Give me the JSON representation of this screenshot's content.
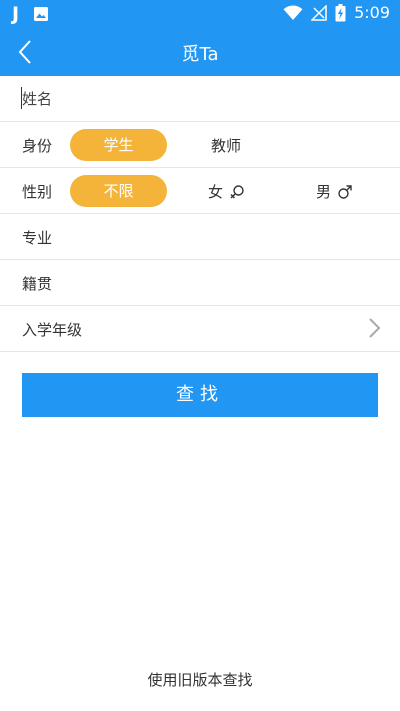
{
  "status": {
    "time": "5:09",
    "left_icons": [
      "j-app-icon",
      "image-icon"
    ],
    "right_icons": [
      "wifi-icon",
      "signal-icon",
      "battery-charging-icon"
    ]
  },
  "header": {
    "title": "觅Ta",
    "back_icon": "chevron-left-icon"
  },
  "form": {
    "name": {
      "placeholder": "姓名",
      "value": ""
    },
    "identity": {
      "label": "身份",
      "options": [
        "学生",
        "教师"
      ],
      "selected": "学生"
    },
    "gender": {
      "label": "性别",
      "options": [
        "不限",
        "女",
        "男"
      ],
      "selected": "不限",
      "icons": [
        "female-icon",
        "male-icon"
      ]
    },
    "major": {
      "label": "专业"
    },
    "hometown": {
      "label": "籍贯"
    },
    "enrollment_year": {
      "label": "入学年级",
      "chevron_icon": "chevron-right-icon"
    }
  },
  "search_button": {
    "label": "查找"
  },
  "old_version_link": {
    "label": "使用旧版本查找"
  },
  "colors": {
    "primary": "#2196f3",
    "accent": "#f4b43a",
    "divider": "#e6e6e6"
  }
}
